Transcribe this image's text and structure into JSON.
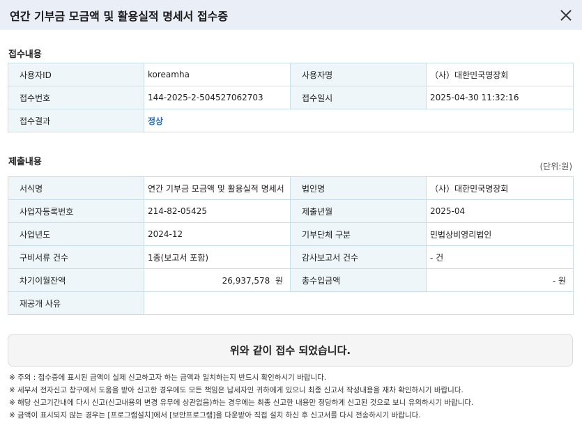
{
  "window": {
    "title": "연간 기부금 모금액 및 활용실적 명세서 접수증"
  },
  "receipt_section": {
    "title": "접수내용",
    "user_id_label": "사용자ID",
    "user_id": "koreamha",
    "user_name_label": "사용자명",
    "user_name": "（사）대한민국명장회",
    "receipt_no_label": "접수번호",
    "receipt_no": "144-2025-2-504527062703",
    "receipt_datetime_label": "접수일시",
    "receipt_datetime": "2025-04-30 11:32:16",
    "receipt_result_label": "접수결과",
    "receipt_result": "정상"
  },
  "submission_section": {
    "title": "제출내용",
    "unit": "(단위:원)",
    "form_name_label": "서식명",
    "form_name": "연간 기부금 모금액 및 활용실적 명세서",
    "corp_name_label": "법인명",
    "corp_name": "（사）대한민국명장회",
    "biz_reg_no_label": "사업자등록번호",
    "biz_reg_no": "214-82-05425",
    "submit_month_label": "제출년월",
    "submit_month": "2025-04",
    "biz_year_label": "사업년도",
    "biz_year": "2024-12",
    "donor_org_type_label": "기부단체 구분",
    "donor_org_type": "민법상비영리법인",
    "docs_count_label": "구비서류 건수",
    "docs_count": "1종(보고서 포함)",
    "audit_report_label": "감사보고서 건수",
    "audit_report": "- 건",
    "carryover_label": "차기이월잔액",
    "carryover": "26,937,578  원",
    "total_income_label": "총수입금액",
    "total_income": "- 원",
    "republish_reason_label": "재공개 사유",
    "republish_reason": ""
  },
  "confirm_message": "위와 같이 접수 되었습니다.",
  "notes": [
    "※ 주의 : 접수증에 표시된 금액이 실제 신고하고자 하는 금액과 일치하는지 반드시 확인하시기 바랍니다.",
    "※ 세무서 전자신고 창구에서 도움을 받아 신고한 경우에도 모든 책임은 납세자인 귀하에게 있으니 최종 신고서 작성내용을 재차 확인하시기 바랍니다.",
    "※ 해당 신고기간내에 다시 신고(신고내용의 변경 유무에 상관없음)하는 경우에는 최종 신고한 내용만 정당하게 신고된 것으로 보니 유의하시기 바랍니다.",
    "※ 금액이 표시되지 않는 경우는 [프로그램설치]에서 [보안프로그램]을 다운받아 직접 설치 하신 후 신고서를 다시 전송하시기 바랍니다."
  ]
}
